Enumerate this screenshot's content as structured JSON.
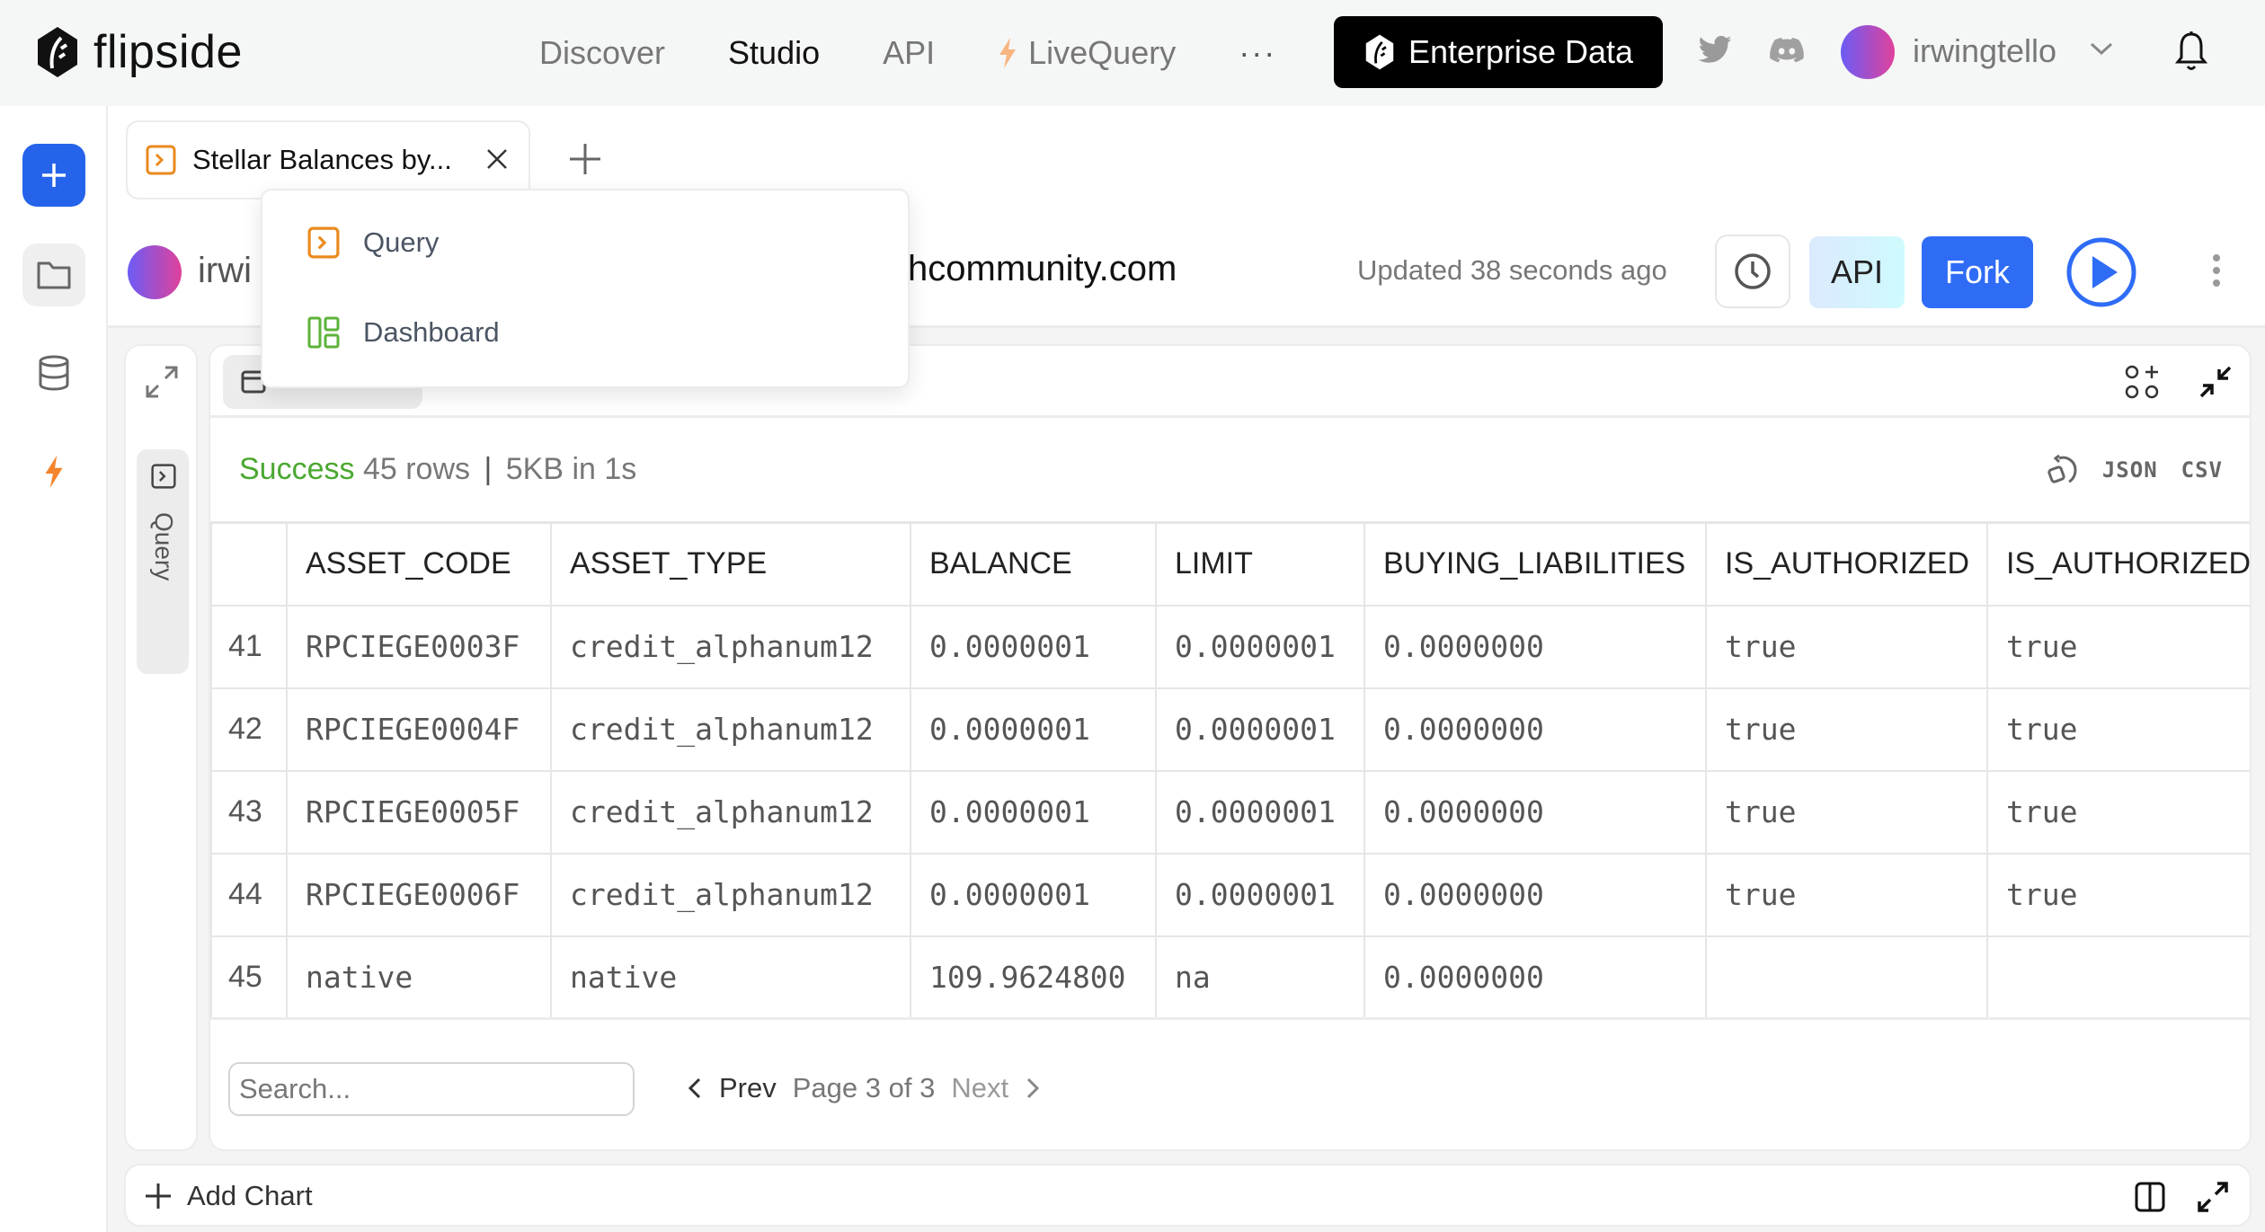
{
  "topnav": {
    "brand": "flipside",
    "links": [
      {
        "label": "Discover",
        "active": false
      },
      {
        "label": "Studio",
        "active": true
      },
      {
        "label": "API",
        "active": false
      },
      {
        "label": "LiveQuery",
        "active": false,
        "icon": "bolt-icon"
      }
    ],
    "more_label": "···",
    "enterprise_label": "Enterprise Data",
    "username": "irwingtello"
  },
  "rail": {
    "items": [
      "new-button",
      "folder",
      "database",
      "livequery"
    ]
  },
  "tabs": [
    {
      "title": "Stellar Balances by...",
      "icon": "query-icon"
    }
  ],
  "dropdown": {
    "items": [
      {
        "label": "Query",
        "icon": "query-icon"
      },
      {
        "label": "Dashboard",
        "icon": "dashboard-icon"
      }
    ]
  },
  "title_row": {
    "owner_name_visible": "irwi",
    "owner_domain_visible": "hcommunity.com",
    "updated": "Updated 38 seconds ago",
    "api_label": "API",
    "fork_label": "Fork"
  },
  "side_panel": {
    "tab_label": "Query"
  },
  "results": {
    "status_ok": "Success",
    "rows": "45 rows",
    "sep": "|",
    "size_time": "5KB in 1s",
    "json_label": "JSON",
    "csv_label": "CSV",
    "columns": [
      "",
      "ASSET_CODE",
      "ASSET_TYPE",
      "BALANCE",
      "LIMIT",
      "BUYING_LIABILITIES",
      "IS_AUTHORIZED",
      "IS_AUTHORIZED_"
    ],
    "data": [
      [
        "41",
        "RPCIEGE0003F",
        "credit_alphanum12",
        "0.0000001",
        "0.0000001",
        "0.0000000",
        "true",
        "true"
      ],
      [
        "42",
        "RPCIEGE0004F",
        "credit_alphanum12",
        "0.0000001",
        "0.0000001",
        "0.0000000",
        "true",
        "true"
      ],
      [
        "43",
        "RPCIEGE0005F",
        "credit_alphanum12",
        "0.0000001",
        "0.0000001",
        "0.0000000",
        "true",
        "true"
      ],
      [
        "44",
        "RPCIEGE0006F",
        "credit_alphanum12",
        "0.0000001",
        "0.0000001",
        "0.0000000",
        "true",
        "true"
      ],
      [
        "45",
        "native",
        "native",
        "109.9624800",
        "na",
        "0.0000000",
        "",
        ""
      ]
    ],
    "search_placeholder": "Search...",
    "prev_label": "Prev",
    "page_label": "Page 3 of 3",
    "next_label": "Next"
  },
  "bottom": {
    "add_chart_label": "Add Chart"
  },
  "colors": {
    "accent_blue": "#2563eb",
    "fork_blue": "#2f6cf6",
    "success_green": "#4aa830",
    "query_orange": "#ea8a1e",
    "dashboard_green": "#5cb33a",
    "bolt_orange": "#f5842a"
  }
}
